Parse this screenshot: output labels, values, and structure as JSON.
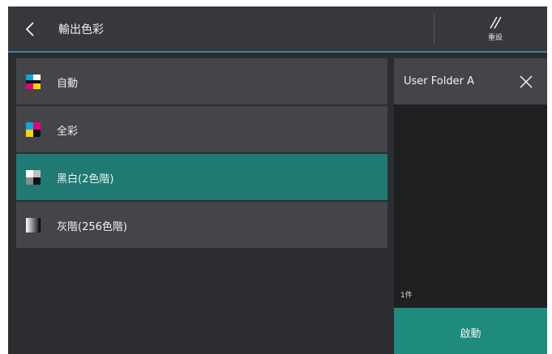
{
  "header": {
    "title": "輸出色彩",
    "reset_label": "重設"
  },
  "options": [
    {
      "label": "自動",
      "icon": "auto-color-icon",
      "selected": false
    },
    {
      "label": "全彩",
      "icon": "full-color-icon",
      "selected": false
    },
    {
      "label": "黑白(2色階)",
      "icon": "black-white-icon",
      "selected": true
    },
    {
      "label": "灰階(256色階)",
      "icon": "grayscale-icon",
      "selected": false
    }
  ],
  "panel": {
    "title": "User Folder A",
    "count": "1件",
    "start_label": "啟動"
  },
  "colors": {
    "accent": "#1f7a73",
    "start_button": "#1f8a7e",
    "header_line": "#3e7fb2"
  }
}
